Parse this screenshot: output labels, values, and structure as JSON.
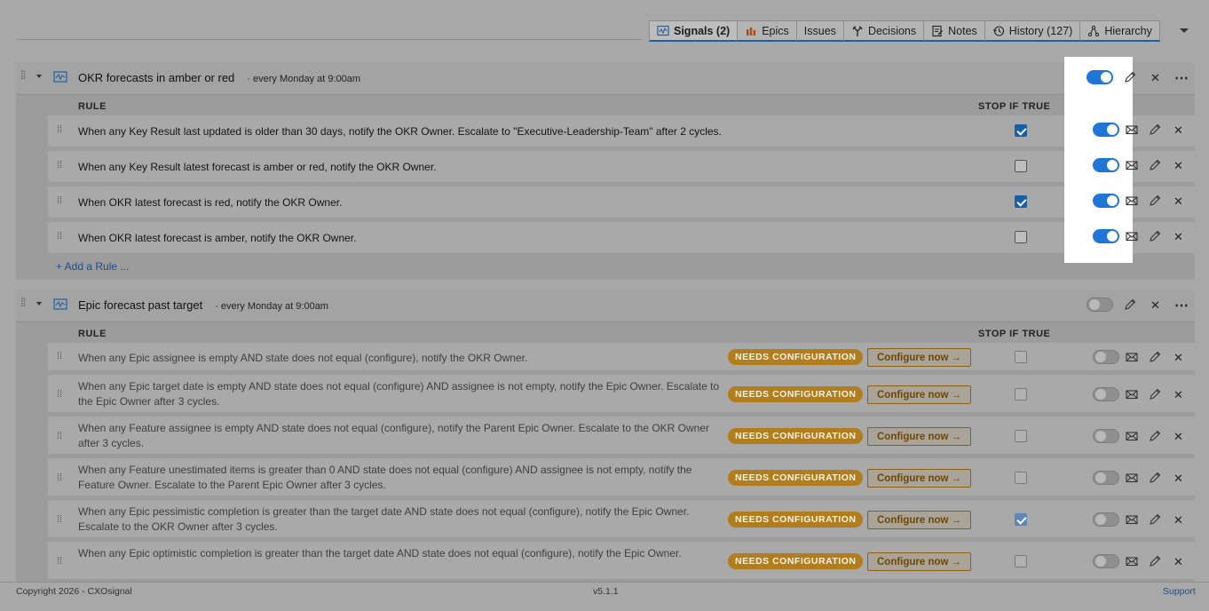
{
  "tabs": [
    {
      "label": "Signals (2)",
      "icon": "signal-icon",
      "active": true
    },
    {
      "label": "Epics",
      "icon": "epic-icon"
    },
    {
      "label": "Issues"
    },
    {
      "label": "Decisions",
      "icon": "decision-icon"
    },
    {
      "label": "Notes",
      "icon": "note-icon"
    },
    {
      "label": "History (127)",
      "icon": "history-icon"
    },
    {
      "label": "Hierarchy",
      "icon": "hierarchy-icon"
    }
  ],
  "column_labels": {
    "rule": "RULE",
    "stop_if_true": "STOP IF TRUE"
  },
  "groups": [
    {
      "title": "OKR forecasts in amber or red",
      "schedule": "· every Monday at 9:00am",
      "enabled": true,
      "add_rule_label": "+ Add a Rule ...",
      "rules": [
        {
          "text": "When any Key Result last updated is older than 30 days, notify the OKR Owner. Escalate to \"Executive-Leadership-Team\" after 2 cycles.",
          "stop": true,
          "enabled": true
        },
        {
          "text": "When any Key Result latest forecast is amber or red, notify the OKR Owner.",
          "stop": false,
          "enabled": true
        },
        {
          "text": "When OKR latest forecast is red, notify the OKR Owner.",
          "stop": true,
          "enabled": true
        },
        {
          "text": "When OKR latest forecast is amber, notify the OKR Owner.",
          "stop": false,
          "enabled": true
        }
      ]
    },
    {
      "title": "Epic forecast past target",
      "schedule": "· every Monday at 9:00am",
      "enabled": false,
      "needs_config_label": "NEEDS CONFIGURATION",
      "configure_label": "Configure now →",
      "rules": [
        {
          "text": "When any Epic assignee is empty AND state does not equal (configure), notify the OKR Owner.",
          "stop": false
        },
        {
          "text": "When any Epic target date is empty AND state does not equal (configure) AND assignee is not empty, notify the Epic Owner. Escalate to the Epic Owner after 3 cycles.",
          "stop": false
        },
        {
          "text": "When any Feature assignee is empty AND state does not equal (configure), notify the Parent Epic Owner. Escalate to the OKR Owner after 3 cycles.",
          "stop": false
        },
        {
          "text": "When any Feature unestimated items is greater than 0 AND state does not equal (configure) AND assignee is not empty, notify the Feature Owner. Escalate to the Parent Epic Owner after 3 cycles.",
          "stop": false
        },
        {
          "text": "When any Epic pessimistic completion is greater than the target date AND state does not equal (configure), notify the Epic Owner. Escalate to the OKR Owner after 3 cycles.",
          "stop": true
        },
        {
          "text": "When any Epic optimistic completion is greater than the target date AND state does not equal (configure), notify the Epic Owner.",
          "stop": false
        }
      ]
    }
  ],
  "footer": {
    "copyright": "Copyright 2026 - CXOsignal",
    "version": "v5.1.1",
    "support": "Support"
  },
  "colors": {
    "accent": "#1f76d6",
    "warning": "#b17d1d",
    "link": "#1a4c8a"
  }
}
